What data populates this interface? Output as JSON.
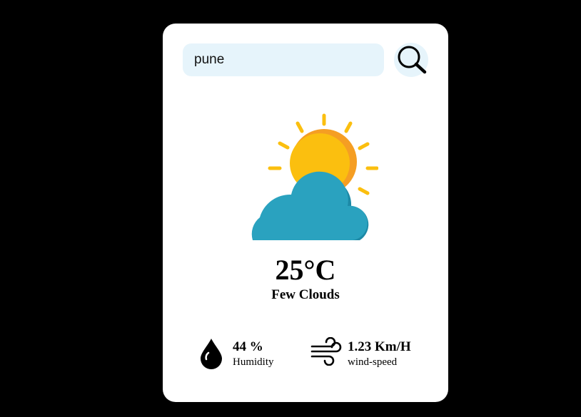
{
  "search": {
    "value": "pune",
    "placeholder": ""
  },
  "search_button_icon": "search-icon",
  "weather": {
    "icon": "sun-behind-cloud-icon",
    "temperature": "25°C",
    "condition": "Few Clouds"
  },
  "humidity": {
    "icon": "water-drop-icon",
    "value": "44 %",
    "label": "Humidity"
  },
  "wind": {
    "icon": "wind-icon",
    "value": "1.23 Km/H",
    "label": "wind-speed"
  },
  "colors": {
    "background": "#000000",
    "card": "#ffffff",
    "input_background": "#e6f4fb",
    "sun": "#fbbf0f",
    "sun_shade": "#f59e23",
    "cloud": "#2aa2bf",
    "cloud_shade": "#1c89a6"
  }
}
